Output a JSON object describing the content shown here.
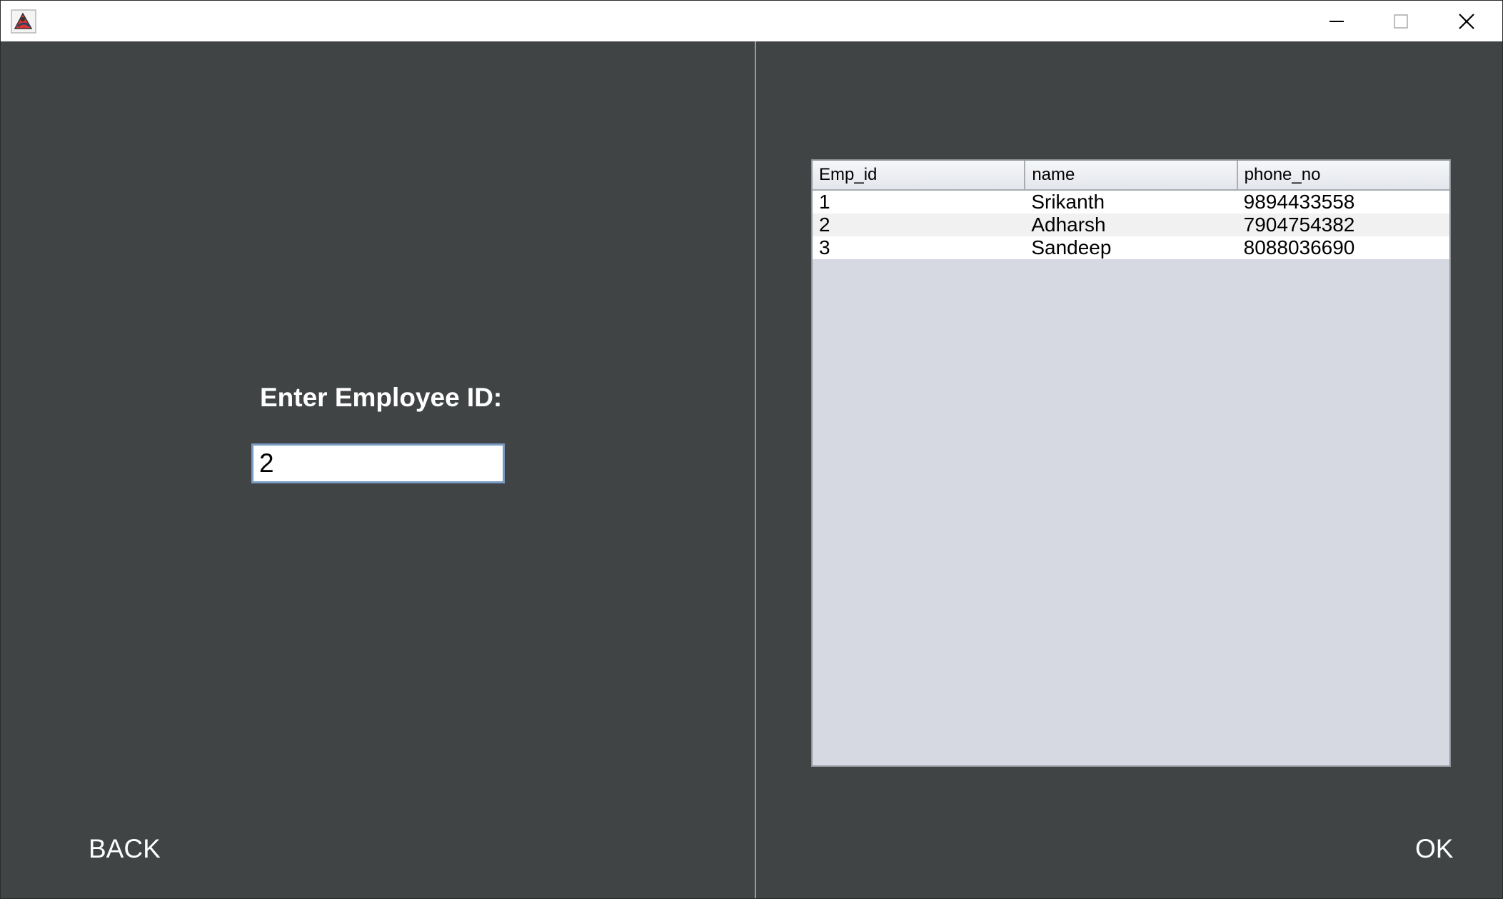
{
  "window": {
    "title": "",
    "controls": [
      "minimize-icon",
      "maximize-icon",
      "close-icon"
    ]
  },
  "left": {
    "prompt": "Enter Employee ID:",
    "employee_id_value": "2",
    "back_label": "BACK"
  },
  "right": {
    "ok_label": "OK",
    "table": {
      "columns": [
        "Emp_id",
        "name",
        "phone_no"
      ],
      "rows": [
        [
          "1",
          "Srikanth",
          "9894433558"
        ],
        [
          "2",
          "Adharsh",
          "7904754382"
        ],
        [
          "3",
          "Sandeep",
          "8088036690"
        ]
      ]
    }
  },
  "colors": {
    "panel_bg": "#404444",
    "table_empty_bg": "#d6d9e1",
    "input_border": "#7a9bc4"
  }
}
